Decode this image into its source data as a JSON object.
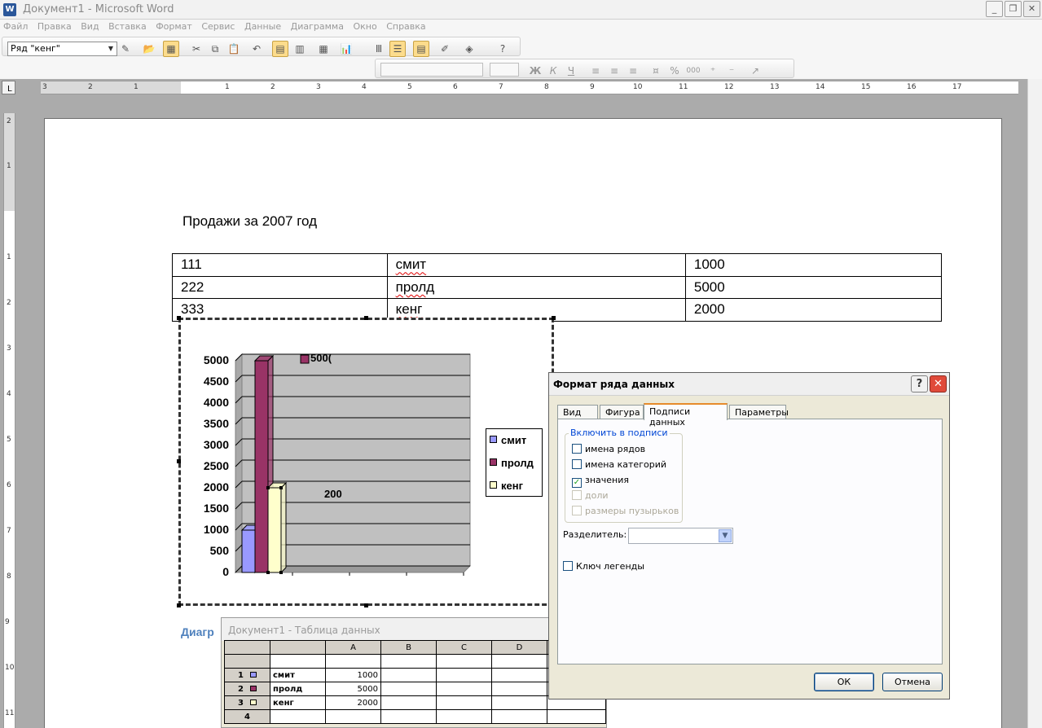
{
  "window": {
    "title": "Документ1 - Microsoft Word",
    "app_icon": "W"
  },
  "menu": [
    "Файл",
    "Правка",
    "Вид",
    "Вставка",
    "Формат",
    "Сервис",
    "Данные",
    "Диаграмма",
    "Окно",
    "Справка"
  ],
  "toolbar": {
    "series_selector": "Ряд \"кенг\"",
    "bold": "Ж",
    "italic": "К",
    "underline": "Ч",
    "percent": "%",
    "thousands": "000"
  },
  "ruler": {
    "h_numbers": [
      "3",
      "2",
      "1",
      "1",
      "2",
      "3",
      "4",
      "5",
      "6",
      "7",
      "8",
      "9",
      "10",
      "11",
      "12",
      "13",
      "14",
      "15",
      "16",
      "17"
    ],
    "v_numbers": [
      "2",
      "1",
      "1",
      "2",
      "3",
      "4",
      "5",
      "6",
      "7",
      "8",
      "9",
      "10",
      "11"
    ]
  },
  "document": {
    "title": "Продажи за 2007 год",
    "table": [
      [
        "111",
        "смит",
        "1000"
      ],
      [
        "222",
        "пролд",
        "5000"
      ],
      [
        "333",
        "кенг",
        "2000"
      ]
    ],
    "caption": "Диагр"
  },
  "colors": {
    "series1": "#9999FF",
    "series2": "#993366",
    "series3": "#FFFFCC",
    "plot_bg": "#C0C0C0",
    "accent": "#4F81BD"
  },
  "chart_data": {
    "type": "bar",
    "categories": [
      ""
    ],
    "series": [
      {
        "name": "смит",
        "values": [
          1000
        ]
      },
      {
        "name": "пролд",
        "values": [
          5000
        ]
      },
      {
        "name": "кенг",
        "values": [
          2000
        ]
      }
    ],
    "ylim": [
      0,
      5000
    ],
    "yticks": [
      "0",
      "500",
      "1000",
      "1500",
      "2000",
      "2500",
      "3000",
      "3500",
      "4000",
      "4500",
      "5000"
    ],
    "data_labels": [
      "500(",
      "200"
    ],
    "legend": "right",
    "grid": true
  },
  "datasheet": {
    "title": "Документ1 - Таблица данных",
    "columns": [
      "A",
      "B",
      "C",
      "D"
    ],
    "rows": [
      {
        "num": "1",
        "name": "смит",
        "a": "1000"
      },
      {
        "num": "2",
        "name": "пролд",
        "a": "5000"
      },
      {
        "num": "3",
        "name": "кенг",
        "a": "2000"
      },
      {
        "num": "4",
        "name": "",
        "a": ""
      }
    ]
  },
  "dialog": {
    "title": "Формат ряда данных",
    "help": "?",
    "tabs": [
      "Вид",
      "Фигура",
      "Подписи данных",
      "Параметры"
    ],
    "active_tab": "Подписи данных",
    "group_label": "Включить в подписи",
    "options": [
      {
        "label": "имена рядов",
        "checked": false,
        "enabled": true
      },
      {
        "label": "имена категорий",
        "checked": false,
        "enabled": true
      },
      {
        "label": "значения",
        "checked": true,
        "enabled": true
      },
      {
        "label": "доли",
        "checked": false,
        "enabled": false
      },
      {
        "label": "размеры пузырьков",
        "checked": false,
        "enabled": false
      }
    ],
    "separator_label": "Разделитель:",
    "separator_value": "",
    "legend_key_label": "Ключ легенды",
    "legend_key_checked": false,
    "ok": "ОК",
    "cancel": "Отмена"
  }
}
